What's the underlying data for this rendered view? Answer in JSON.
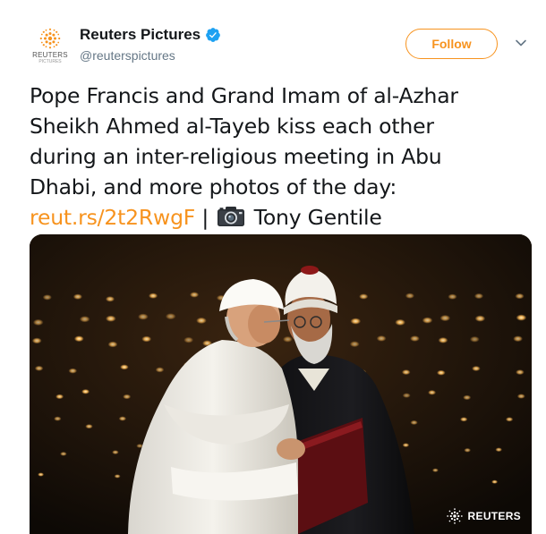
{
  "account": {
    "display_name": "Reuters Pictures",
    "handle": "@reuterspictures",
    "verified": true,
    "avatar_logo_text": "REUTERS",
    "avatar_logo_subtext": "PICTURES",
    "avatar_icon": "reuters-logo-icon"
  },
  "actions": {
    "follow_label": "Follow",
    "menu_icon": "chevron-down-icon"
  },
  "tweet": {
    "line1": "Pope Francis and Grand Imam of al-Azhar",
    "line2": "Sheikh Ahmed al-Tayeb kiss each other",
    "line3": "during an inter-religious meeting in Abu",
    "line4": "Dhabi, and more photos of the day:",
    "link": "reut.rs/2t2RwgF",
    "separator": "|",
    "camera_icon": "camera-icon",
    "credit": "Tony Gentile"
  },
  "photo": {
    "watermark": "REUTERS"
  },
  "colors": {
    "accent": "#f7931e",
    "verified_blue": "#1da1f2",
    "text": "#14171a",
    "secondary": "#657786"
  }
}
